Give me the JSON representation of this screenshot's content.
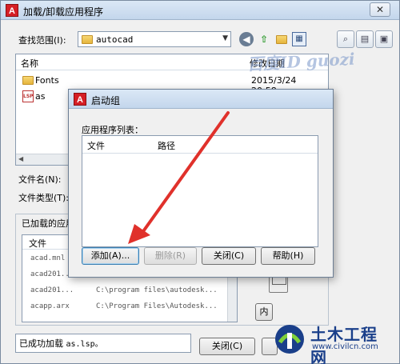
{
  "outer": {
    "title": "加载/卸载应用程序",
    "app_icon": "A",
    "close": "✕",
    "look_in_label": "查找范围(I):",
    "path": "autocad",
    "list_header_name": "名称",
    "list_header_date": "修改日期",
    "files": [
      {
        "name": "Fonts",
        "date": "2015/3/24 20:58",
        "icon": "folder-icon"
      },
      {
        "name": "as",
        "date": "",
        "icon": "lsp-file-icon"
      }
    ],
    "file_name_label": "文件名(N):",
    "file_type_label": "文件类型(T):",
    "loaded_group_label": "已加载的应用",
    "loaded_header_file": "文件",
    "loaded_rows": [
      {
        "file": "acad.mnl",
        "path": ""
      },
      {
        "file": "acad201...",
        "path": ""
      },
      {
        "file": "acad201...",
        "path": "C:\\program files\\autodesk..."
      },
      {
        "file": "acapp.arx",
        "path": "C:\\Program Files\\Autodesk..."
      }
    ],
    "content_button": "内",
    "status_prefix": "已成功加载",
    "status_file": "as.lsp。",
    "close_button": "关闭(C)",
    "watermark": "百度ID guozi"
  },
  "inner": {
    "title": "启动组",
    "app_icon": "A",
    "list_label": "应用程序列表：",
    "col_file": "文件",
    "col_path": "路径",
    "buttons": {
      "add": "添加(A)...",
      "remove": "删除(R)",
      "close": "关闭(C)",
      "help": "帮助(H)"
    }
  },
  "logo": {
    "title": "土木工程网",
    "url": "www.civilcn.com"
  },
  "colors": {
    "arrow": "#e0312b",
    "logo_blue": "#1a3f8a",
    "acad_red": "#d51f26"
  }
}
